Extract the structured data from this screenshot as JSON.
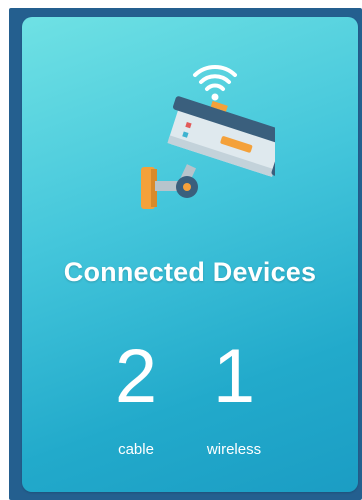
{
  "widget": {
    "icon": "security-camera-wifi-icon",
    "title": "Connected Devices",
    "stats": [
      {
        "count": "2",
        "label": "cable"
      },
      {
        "count": "1",
        "label": "wireless"
      }
    ],
    "colors": {
      "card_gradient_start": "#6fe1e4",
      "card_gradient_end": "#1b9dc4",
      "frame": "#245f8f",
      "camera_body": "#dfe9ee",
      "camera_top": "#3a5f7d",
      "accent": "#f4a13a",
      "text": "#ffffff"
    }
  }
}
